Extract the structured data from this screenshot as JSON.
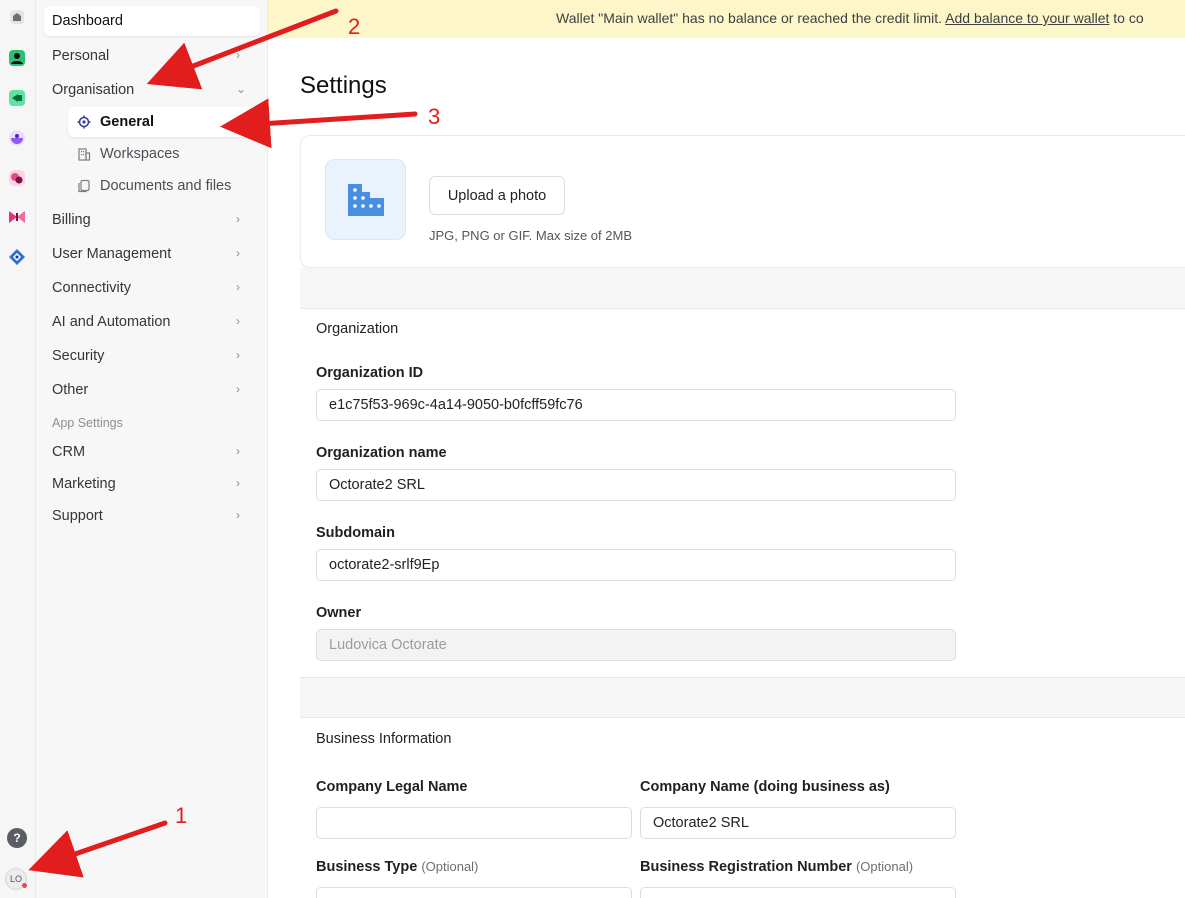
{
  "rail": {
    "apps": [
      {
        "icon": "home-icon",
        "color": "#6b6e73"
      },
      {
        "icon": "user-app-icon",
        "color": "#2fbf71"
      },
      {
        "icon": "video-app-icon",
        "color": "#1fb36b"
      },
      {
        "icon": "purple-app-icon",
        "color": "#8b5cf6"
      },
      {
        "icon": "pink-app-icon",
        "color": "#e64a8c"
      },
      {
        "icon": "butterfly-app-icon",
        "color": "#e0357a"
      },
      {
        "icon": "blue-app-icon",
        "color": "#2f6fd6"
      }
    ],
    "help_label": "?",
    "avatar_initials": "LO"
  },
  "sidebar": {
    "dashboard": "Dashboard",
    "personal": "Personal",
    "organisation": "Organisation",
    "sub_items": [
      "General",
      "Workspaces",
      "Documents and files"
    ],
    "billing": "Billing",
    "user_management": "User Management",
    "connectivity": "Connectivity",
    "ai_automation": "AI and Automation",
    "security": "Security",
    "other": "Other",
    "app_settings_label": "App Settings",
    "crm": "CRM",
    "marketing": "Marketing",
    "support": "Support"
  },
  "banner": {
    "text": "Wallet \"Main wallet\" has no balance or reached the credit limit.",
    "link": "Add balance to your wallet",
    "tail": "to co"
  },
  "page": {
    "title": "Settings",
    "upload_button": "Upload a photo",
    "upload_hint": "JPG, PNG or GIF. Max size of 2MB"
  },
  "organization": {
    "section_title": "Organization",
    "id_label": "Organization ID",
    "id_value": "e1c75f53-969c-4a14-9050-b0fcff59fc76",
    "name_label": "Organization name",
    "name_value": "Octorate2 SRL",
    "subdomain_label": "Subdomain",
    "subdomain_value": "octorate2-srlf9Ep",
    "owner_label": "Owner",
    "owner_value": "Ludovica Octorate"
  },
  "business": {
    "section_title": "Business Information",
    "legal_name_label": "Company Legal Name",
    "legal_name_value": "",
    "dba_label": "Company Name (doing business as)",
    "dba_value": "Octorate2 SRL",
    "type_label": "Business Type",
    "reg_label": "Business Registration Number",
    "optional": "(Optional)"
  },
  "annotations": {
    "arrow_1": "1",
    "arrow_2": "2",
    "arrow_3": "3",
    "color": "#e11d1d"
  }
}
